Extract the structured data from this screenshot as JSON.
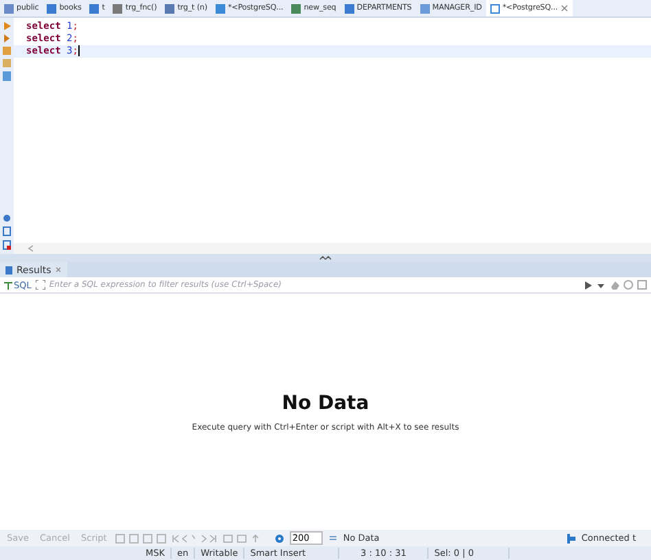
{
  "editor_tabs": [
    {
      "label": "public",
      "kind": "schema",
      "selected": false
    },
    {
      "label": "books",
      "kind": "table",
      "selected": false
    },
    {
      "label": "t",
      "kind": "table",
      "selected": false
    },
    {
      "label": "trg_fnc()",
      "kind": "function",
      "selected": false
    },
    {
      "label": "trg_t (n)",
      "kind": "trigger",
      "selected": false
    },
    {
      "label": "*<PostgreSQ...",
      "kind": "script",
      "selected": false
    },
    {
      "label": "new_seq",
      "kind": "sequence",
      "selected": false
    },
    {
      "label": "DEPARTMENTS",
      "kind": "table",
      "selected": false
    },
    {
      "label": "MANAGER_ID",
      "kind": "column",
      "selected": false
    },
    {
      "label": "*<PostgreSQ...",
      "kind": "script",
      "selected": true
    }
  ],
  "editor": {
    "lines": [
      {
        "keyword": "select",
        "value": "1",
        "punct": ";",
        "current": false
      },
      {
        "keyword": "select",
        "value": "2",
        "punct": ";",
        "current": false
      },
      {
        "keyword": "select",
        "value": "3",
        "punct": ";",
        "current": true
      }
    ]
  },
  "results_tab": {
    "label": "Results"
  },
  "filter": {
    "sql_label": "SQL",
    "placeholder": "Enter a SQL expression to filter results (use Ctrl+Space)"
  },
  "empty_state": {
    "title": "No Data",
    "hint": "Execute query with Ctrl+Enter or script with Alt+X to see results"
  },
  "toolbar": {
    "buttons": [
      {
        "label": "Save",
        "disabled": true
      },
      {
        "label": "Cancel",
        "disabled": true
      },
      {
        "label": "Script",
        "disabled": true
      }
    ],
    "fetch_size": "200",
    "status": "No Data",
    "connection": "Connected t"
  },
  "status_bar": [
    "MSK",
    "en",
    "Writable",
    "Smart Insert",
    "3 : 10 : 31",
    "Sel: 0 | 0"
  ]
}
